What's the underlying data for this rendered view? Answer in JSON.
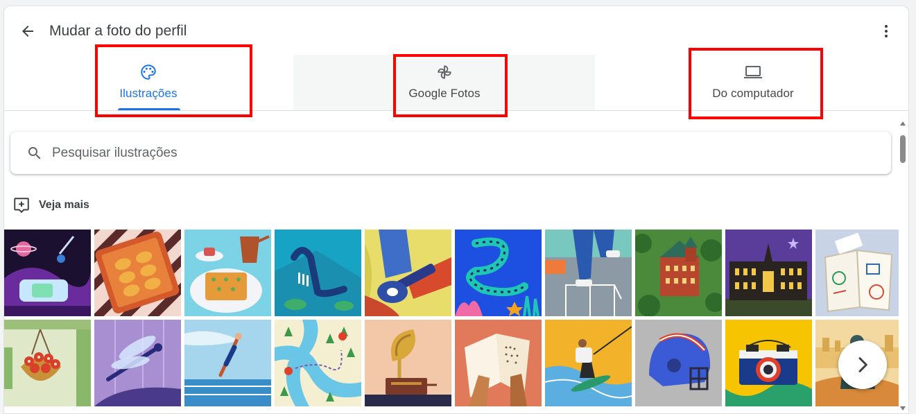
{
  "header": {
    "title": "Mudar a foto do perfil",
    "back_icon": "arrow-back-icon",
    "more_icon": "more-vert-icon"
  },
  "tabs": [
    {
      "label": "Ilustrações",
      "icon": "palette-icon",
      "active": true
    },
    {
      "label": "Google Fotos",
      "icon": "pinwheel-icon",
      "active": false
    },
    {
      "label": "Do computador",
      "icon": "laptop-icon",
      "active": false
    }
  ],
  "search": {
    "placeholder": "Pesquisar ilustrações",
    "value": ""
  },
  "see_more": {
    "label": "Veja mais",
    "icon": "add-to-photo-icon"
  },
  "illustrations": [
    {
      "name": "space-vr",
      "bg": "#6a2c9c"
    },
    {
      "name": "bread-tray",
      "bg": "#5b2a2a"
    },
    {
      "name": "coffee-baklava",
      "bg": "#7dd3e6"
    },
    {
      "name": "sea-serpent",
      "bg": "#17a3c4"
    },
    {
      "name": "guitarist",
      "bg": "#e8dd6a"
    },
    {
      "name": "eel",
      "bg": "#1d4fe0"
    },
    {
      "name": "hopscotch",
      "bg": "#8c9aa6"
    },
    {
      "name": "castle",
      "bg": "#4a8a3a"
    },
    {
      "name": "night-building",
      "bg": "#5a3c9a"
    },
    {
      "name": "travel-journal",
      "bg": "#c9d3e6"
    },
    {
      "name": "hanging-plant",
      "bg": "#dfe8c9"
    },
    {
      "name": "dragonfly",
      "bg": "#a88fd1"
    },
    {
      "name": "diver",
      "bg": "#a6d6ee"
    },
    {
      "name": "map",
      "bg": "#f4efd0"
    },
    {
      "name": "gramophone",
      "bg": "#f2c8a8"
    },
    {
      "name": "braille-book",
      "bg": "#e07a5a"
    },
    {
      "name": "wakeboarder",
      "bg": "#f2b32a"
    },
    {
      "name": "football-helmet",
      "bg": "#b8b8b8"
    },
    {
      "name": "camera",
      "bg": "#f6c400"
    },
    {
      "name": "seaside-person",
      "bg": "#f3d9a0"
    }
  ],
  "colors": {
    "accent": "#1a73e8",
    "highlight": "#ff0000",
    "text": "#3c4043"
  },
  "navigation": {
    "next_icon": "chevron-right-icon"
  }
}
